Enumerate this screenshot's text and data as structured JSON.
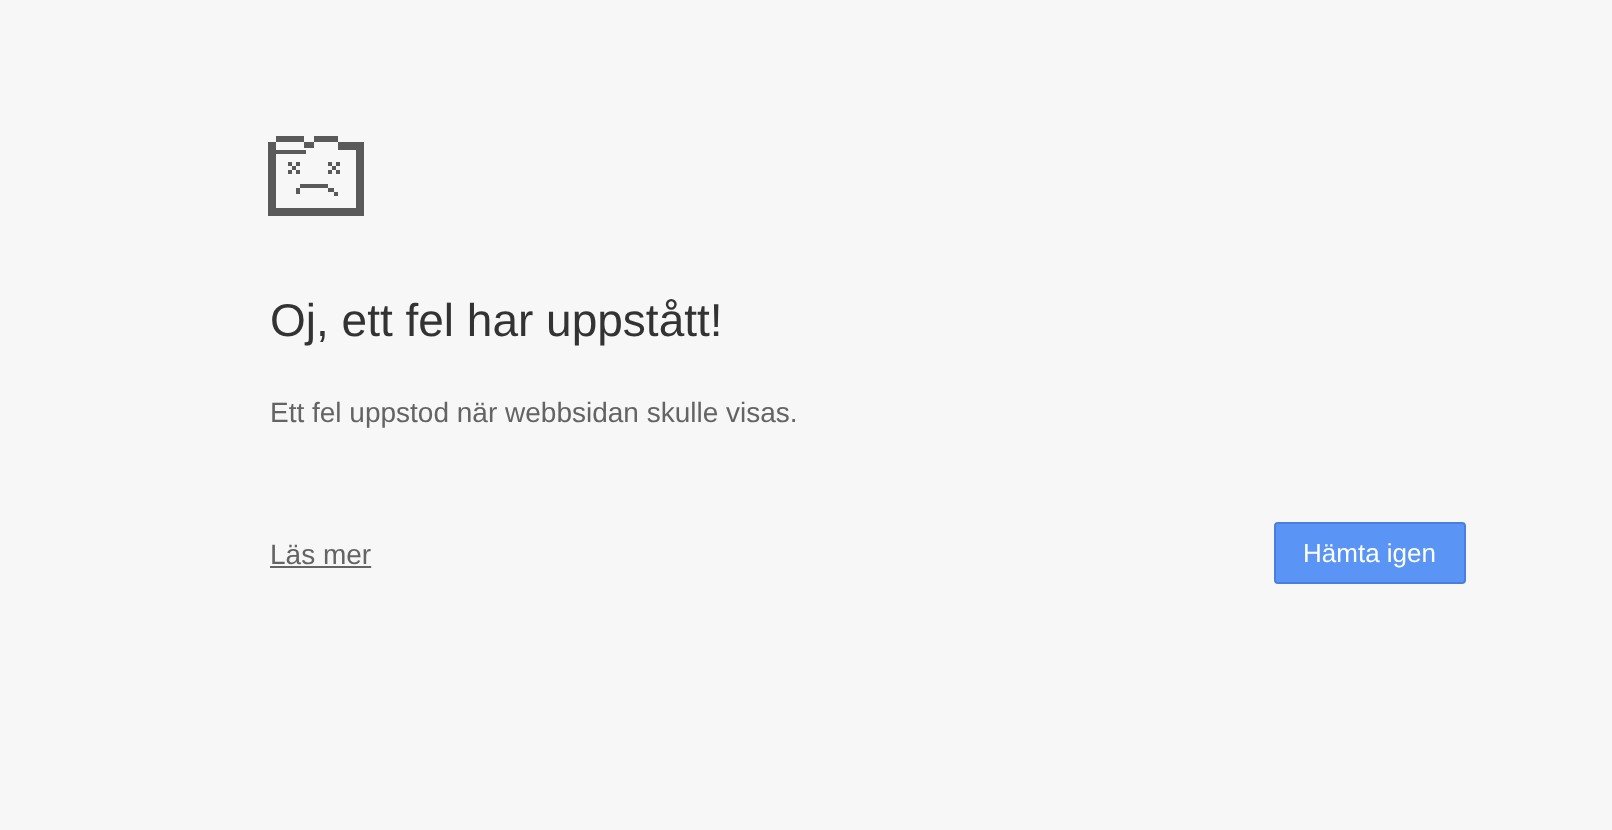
{
  "heading": "Oj, ett fel har uppstått!",
  "message": "Ett fel uppstod när webbsidan skulle visas.",
  "details_link": "Läs mer",
  "reload_button": "Hämta igen"
}
